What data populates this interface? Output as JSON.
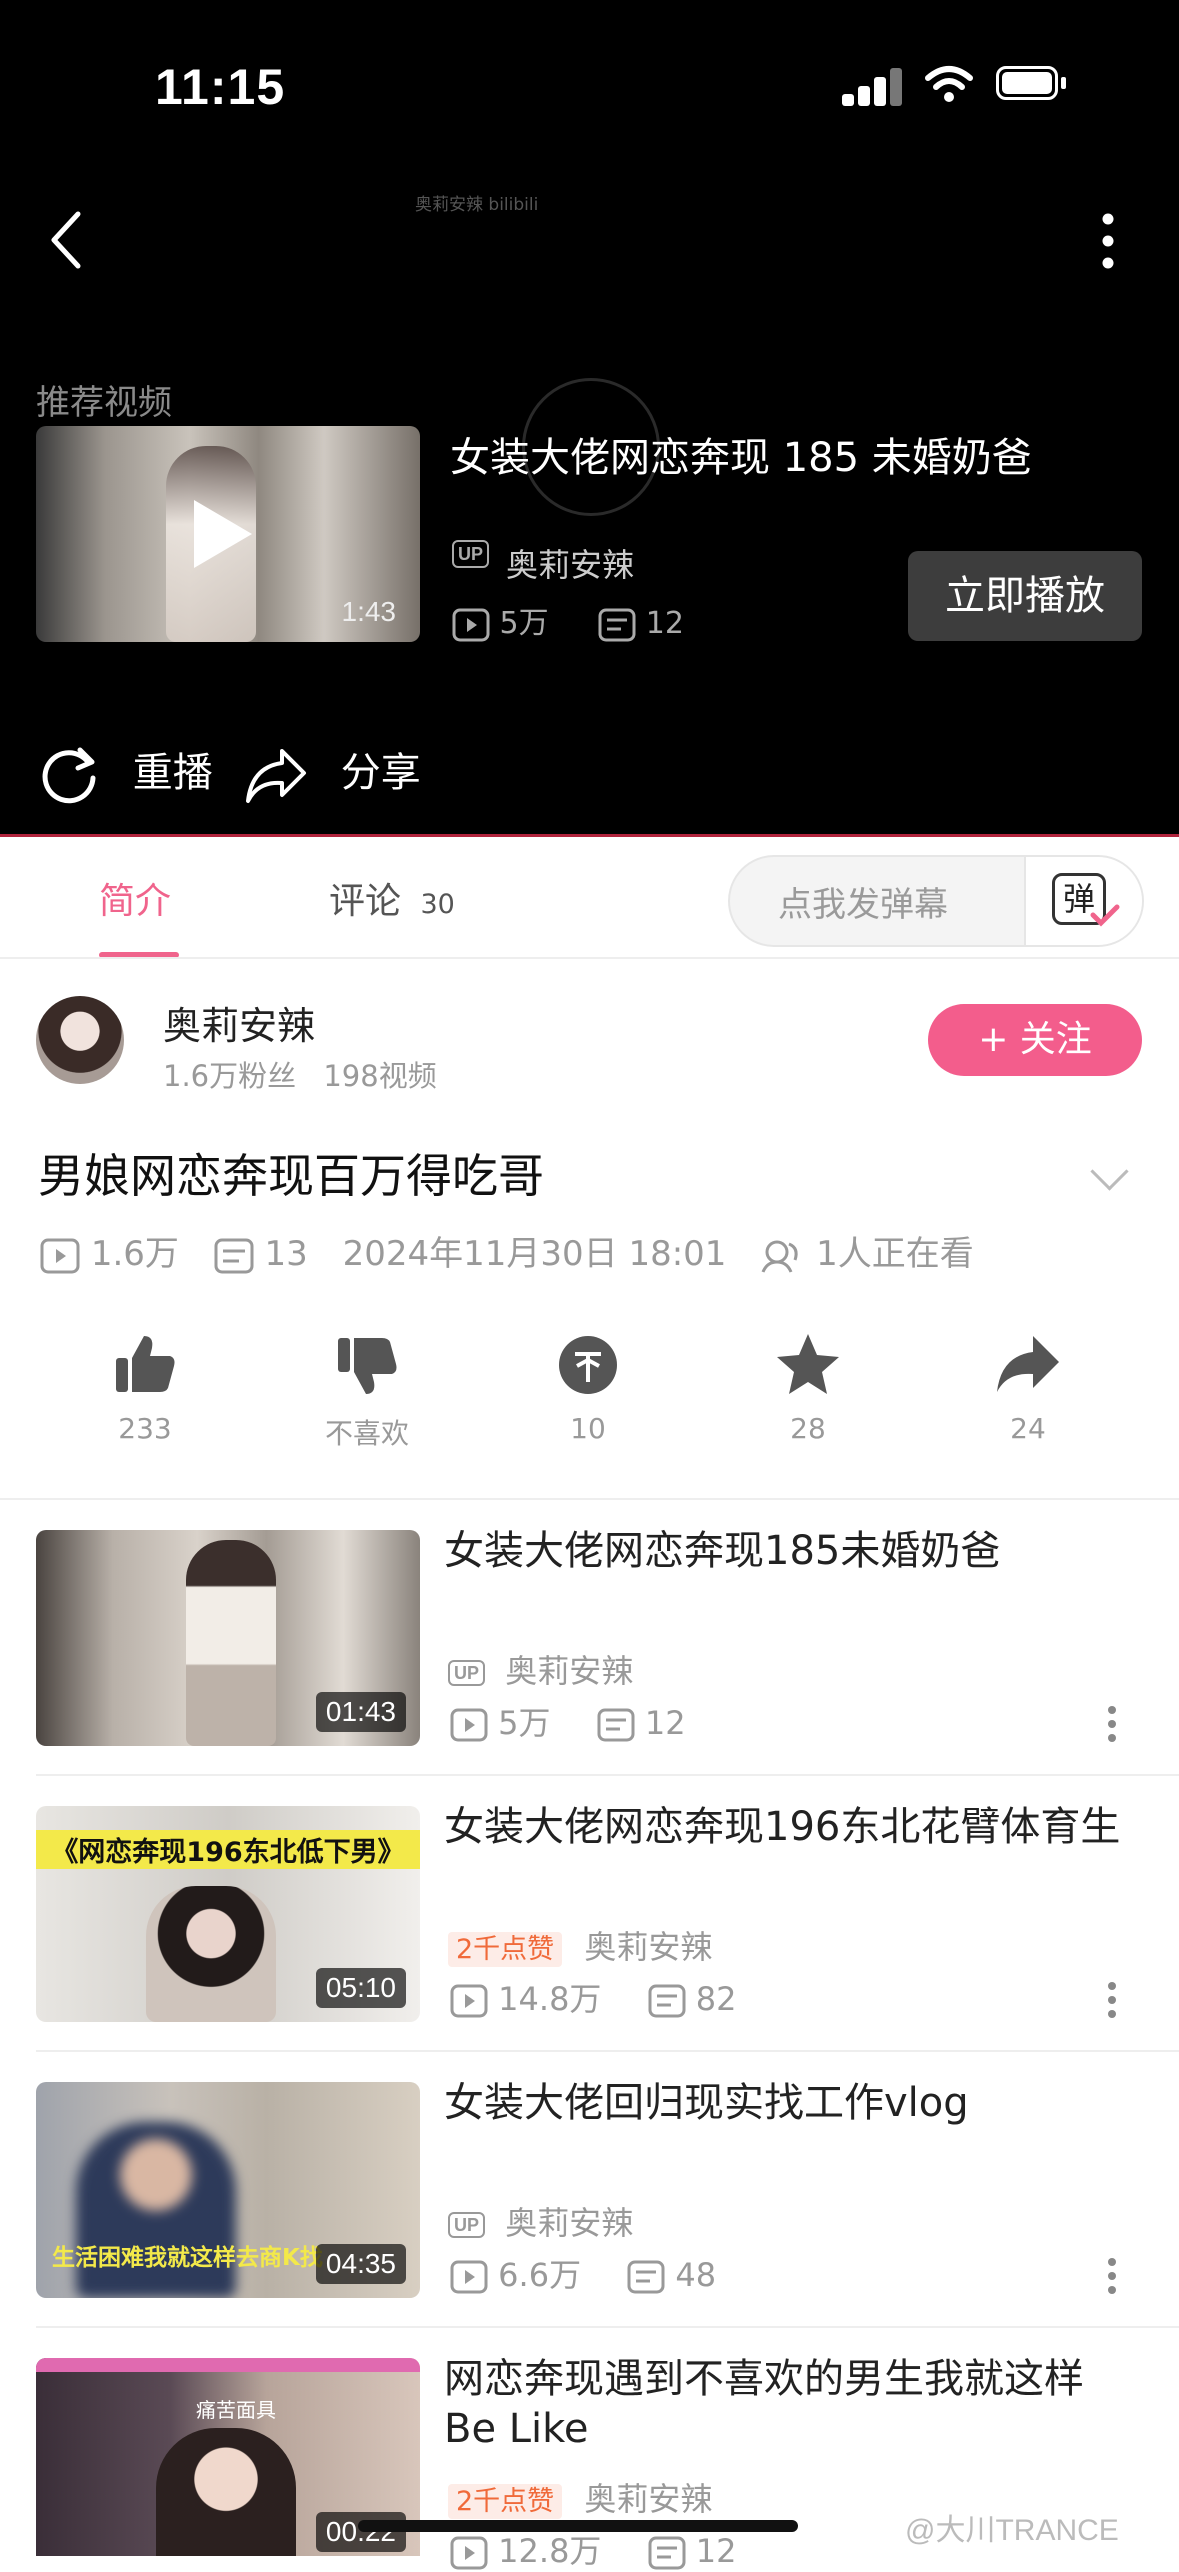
{
  "status_bar": {
    "time": "11:15"
  },
  "player": {
    "watermark": "奥莉安辣 bilibili",
    "recommend_label": "推荐视频",
    "rec_duration": "1:43",
    "rec_title": "女装大佬网恋奔现 185 未婚奶爸",
    "rec_up_badge": "UP",
    "rec_up_name": "奥莉安辣",
    "rec_views": "5万",
    "rec_danmaku": "12",
    "play_now": "立即播放",
    "replay": "重播",
    "share": "分享"
  },
  "tabs": {
    "intro": "简介",
    "comments": "评论",
    "comments_count": "30",
    "danmaku_placeholder": "点我发弹幕",
    "danmaku_icon_text": "弹"
  },
  "uploader": {
    "name": "奥莉安辣",
    "fans": "1.6万粉丝",
    "videos": "198视频",
    "follow": "+ 关注"
  },
  "video": {
    "title": "男娘网恋奔现百万得吃哥",
    "views": "1.6万",
    "danmaku": "13",
    "date": "2024年11月30日 18:01",
    "watching": "1人正在看"
  },
  "actions": {
    "like": "233",
    "dislike": "不喜欢",
    "coin": "10",
    "favorite": "28",
    "share": "24"
  },
  "list": [
    {
      "title": "女装大佬网恋奔现185未婚奶爸",
      "duration": "01:43",
      "up_badge": "UP",
      "likes_badge": "",
      "up": "奥莉安辣",
      "views": "5万",
      "danmaku": "12"
    },
    {
      "title": "女装大佬网恋奔现196东北花臂体育生",
      "duration": "05:10",
      "up_badge": "",
      "likes_badge": "2千点赞",
      "up": "奥莉安辣",
      "views": "14.8万",
      "danmaku": "82",
      "thumb_text": "《网恋奔现196东北低下男》"
    },
    {
      "title": "女装大佬回归现实找工作vlog",
      "duration": "04:35",
      "up_badge": "UP",
      "likes_badge": "",
      "up": "奥莉安辣",
      "views": "6.6万",
      "danmaku": "48",
      "thumb_text": "生活困难我就这样去商K找"
    },
    {
      "title": "网恋奔现遇到不喜欢的男生我就这样 Be Like",
      "duration": "00:22",
      "up_badge": "",
      "likes_badge": "2千点赞",
      "up": "奥莉安辣",
      "views": "12.8万",
      "danmaku": "12",
      "thumb_text": "痛苦面具"
    }
  ],
  "footer": {
    "weibo": "@大川TRANCE"
  },
  "colors": {
    "accent": "#f0648c",
    "follow": "#f35d8c",
    "player_bg": "#000000"
  }
}
